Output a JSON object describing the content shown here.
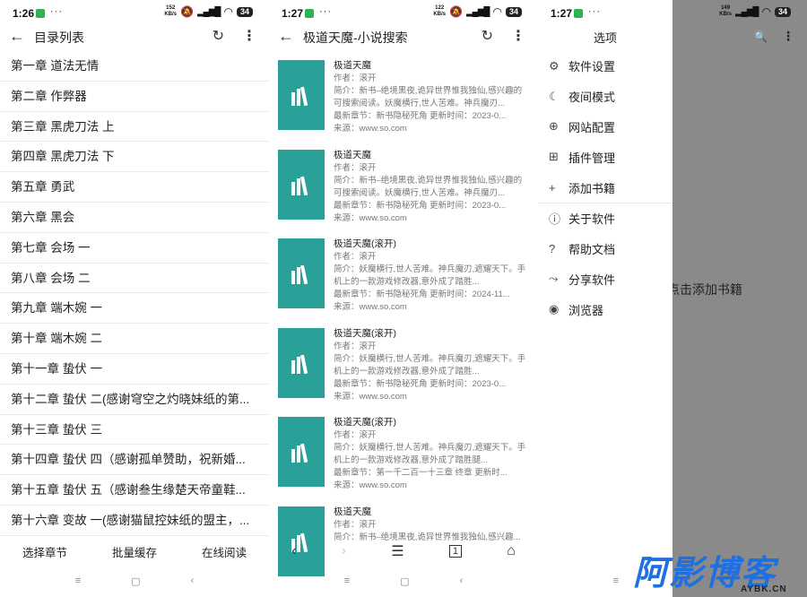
{
  "panel1": {
    "status": {
      "time": "1:26",
      "dots": "···",
      "net_top": "152",
      "net_bottom": "KB/s",
      "battery": "34"
    },
    "title": "目录列表",
    "chapters": [
      "第一章 道法无情",
      "第二章 作弊器",
      "第三章 黑虎刀法 上",
      "第四章 黑虎刀法 下",
      "第五章 勇武",
      "第六章 黑会",
      "第七章 会场 一",
      "第八章 会场 二",
      "第九章 端木婉 一",
      "第十章 端木婉 二",
      "第十一章 蛰伏 一",
      "第十二章 蛰伏 二(感谢穹空之灼晓妹纸的第...",
      "第十三章 蛰伏 三",
      "第十四章 蛰伏 四（感谢孤单赞助，祝新婚...",
      "第十五章 蛰伏 五（感谢叁生缘楚天帝童鞋...",
      "第十六章 变故 一(感谢猫鼠控妹纸的盟主，..."
    ],
    "bottom_tabs": [
      "选择章节",
      "批量缓存",
      "在线阅读"
    ]
  },
  "panel2": {
    "status": {
      "time": "1:27",
      "dots": "···",
      "net_top": "122",
      "net_bottom": "KB/s",
      "battery": "34"
    },
    "title": "极道天魔-小说搜索",
    "results": [
      {
        "title": "极道天魔",
        "author": "作者：滚开",
        "intro": "简介：新书–绝境黑夜,诡异世界惟我独仙,感兴趣的可搜索阅读。妖魔横行,世人苦难。神兵魔刃...",
        "latest": "最新章节：新书隐秘死角 更新时间：2023-0...",
        "source": "来源：www.so.com"
      },
      {
        "title": "极道天魔",
        "author": "作者：滚开",
        "intro": "简介：新书–绝境黑夜,诡异世界惟我独仙,感兴趣的可搜索阅读。妖魔横行,世人苦难。神兵魔刃...",
        "latest": "最新章节：新书隐秘死角 更新时间：2023-0...",
        "source": "来源：www.so.com"
      },
      {
        "title": "极道天魔(滚开)",
        "author": "作者：滚开",
        "intro": "简介：妖魔横行,世人苦难。神兵魔刃,遮耀天下。手机上的一款游戏修改器,意外成了踏胜...",
        "latest": "最新章节：新书隐秘死角 更新时间：2024-11...",
        "source": "来源：www.so.com"
      },
      {
        "title": "极道天魔(滚开)",
        "author": "作者：滚开",
        "intro": "简介：妖魔横行,世人苦难。神兵魔刃,遮耀天下。手机上的一款游戏修改器,意外成了踏胜...",
        "latest": "最新章节：新书隐秘死角 更新时间：2023-0...",
        "source": "来源：www.so.com"
      },
      {
        "title": "极道天魔(滚开)",
        "author": "作者：滚开",
        "intro": "简介：妖魔横行,世人苦难。神兵魔刃,遮耀天下。手机上的一款游戏修改器,意外成了踏胜腿...",
        "latest": "最新章节：第一千二百一十三章 终章 更新时...",
        "source": "来源：www.so.com"
      },
      {
        "title": "极道天魔",
        "author": "作者：滚开",
        "intro": "简介：新书–绝境黑夜,诡异世界惟我独仙,感兴趣...",
        "latest": "",
        "source": ""
      }
    ],
    "tab_count": "1"
  },
  "panel3": {
    "status": {
      "time": "1:27",
      "net_top": "149",
      "net_bottom": "KB/s",
      "battery": "34"
    },
    "drawer_title": "选项",
    "menu": [
      {
        "icon": "gear-icon",
        "label": "软件设置"
      },
      {
        "icon": "moon-icon",
        "label": "夜间模式"
      },
      {
        "icon": "globe-icon",
        "label": "网站配置"
      },
      {
        "icon": "grid-icon",
        "label": "插件管理"
      },
      {
        "icon": "plus-icon",
        "label": "添加书籍"
      },
      {
        "icon": "info-icon",
        "label": "关于软件"
      },
      {
        "icon": "help-icon",
        "label": "帮助文档"
      },
      {
        "icon": "share-icon",
        "label": "分享软件"
      },
      {
        "icon": "browser-icon",
        "label": "浏览器"
      }
    ],
    "background_hint": "点击添加书籍"
  },
  "watermark": {
    "big": "阿影博客",
    "small": "AYBK.CN"
  },
  "colors": {
    "cover": "#2aa198",
    "overlay": "#8a8a8a",
    "watermark": "#1e6fe0"
  }
}
